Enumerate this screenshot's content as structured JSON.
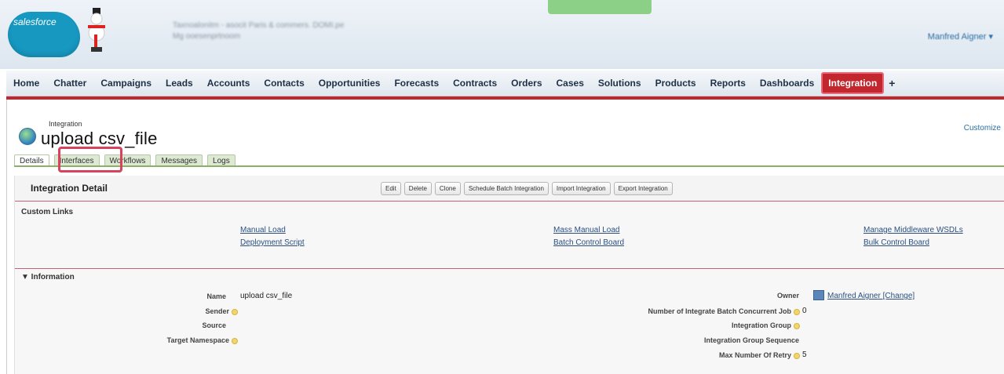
{
  "header": {
    "logo_text": "salesforce",
    "blurred_line1": "Taxnoalonitm - asocit Paris & commers. DOMI.pe",
    "blurred_line2": "Mg ooesenprtnoom",
    "user_name": "Manfred Aigner",
    "user_caret": "▾"
  },
  "nav": {
    "tabs": [
      "Home",
      "Chatter",
      "Campaigns",
      "Leads",
      "Accounts",
      "Contacts",
      "Opportunities",
      "Forecasts",
      "Contracts",
      "Orders",
      "Cases",
      "Solutions",
      "Products",
      "Reports",
      "Dashboards",
      "Integration"
    ],
    "active_tab": "Integration",
    "plus": "+"
  },
  "page": {
    "type_label": "Integration",
    "title": "upload csv_file",
    "customize_link": "Customize"
  },
  "subtabs": [
    "Details",
    "Interfaces",
    "Workflows",
    "Messages",
    "Logs"
  ],
  "detail": {
    "title": "Integration Detail",
    "buttons": [
      "Edit",
      "Delete",
      "Clone",
      "Schedule Batch Integration",
      "Import Integration",
      "Export Integration"
    ]
  },
  "custom_links": {
    "heading": "Custom Links",
    "links": [
      "Manual Load",
      "Deployment Script",
      "Mass Manual Load",
      "Batch Control Board",
      "Manage Middleware WSDLs",
      "Bulk Control Board"
    ]
  },
  "information": {
    "heading": "▼ Information",
    "left_fields": [
      {
        "label": "Name",
        "value": "upload csv_file"
      },
      {
        "label": "Sender",
        "value": ""
      },
      {
        "label": "Source",
        "value": ""
      },
      {
        "label": "Target Namespace",
        "value": ""
      }
    ],
    "right_fields": [
      {
        "label": "Owner",
        "value": "Manfred Aigner [Change]"
      },
      {
        "label": "Number of Integrate Batch Concurrent Job",
        "value": "0"
      },
      {
        "label": "Integration Group",
        "value": ""
      },
      {
        "label": "Integration Group Sequence",
        "value": ""
      },
      {
        "label": "Max Number Of Retry",
        "value": "5"
      }
    ]
  },
  "colors": {
    "accent_red": "#c1272d",
    "nav_bg": "#dfe7ef",
    "link_blue": "#2b4f7e",
    "highlight_pink": "#d9425d"
  }
}
